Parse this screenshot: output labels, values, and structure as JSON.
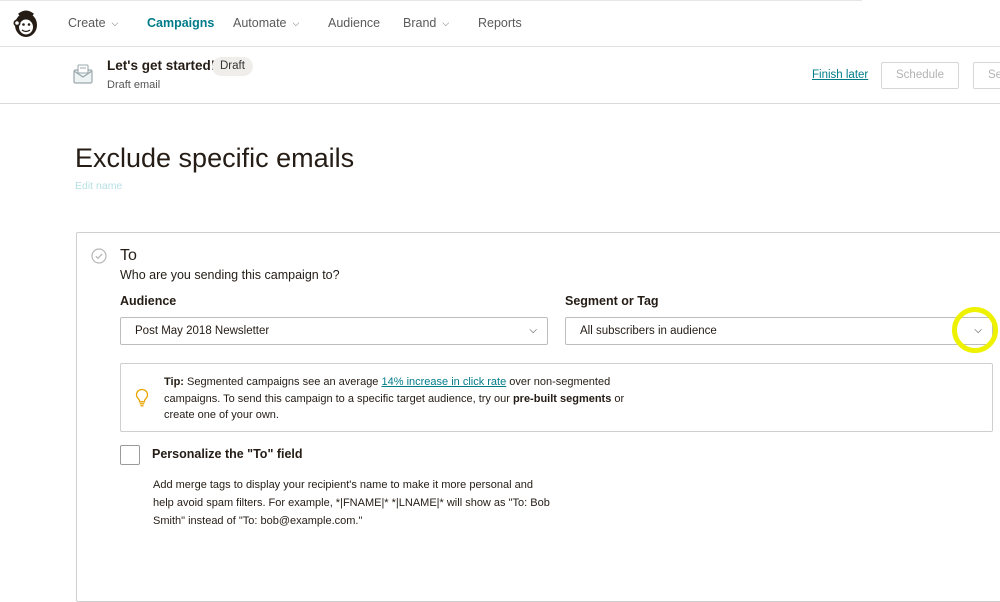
{
  "nav": {
    "items": [
      {
        "label": "Create",
        "has_menu": true
      },
      {
        "label": "Campaigns",
        "has_menu": false,
        "active": true
      },
      {
        "label": "Automate",
        "has_menu": true
      },
      {
        "label": "Audience",
        "has_menu": false
      },
      {
        "label": "Brand",
        "has_menu": true
      },
      {
        "label": "Reports",
        "has_menu": false
      }
    ]
  },
  "campaign": {
    "title": "Let's get started!",
    "status_badge": "Draft",
    "type": "Draft email",
    "finish_later": "Finish later",
    "schedule": "Schedule",
    "send": "Se"
  },
  "page": {
    "title": "Exclude specific emails",
    "edit_name": "Edit name"
  },
  "to_section": {
    "title": "To",
    "subtitle": "Who are you sending this campaign to?",
    "audience_label": "Audience",
    "audience_value": "Post May 2018 Newsletter",
    "segment_label": "Segment or Tag",
    "segment_value": "All subscribers in audience",
    "tip": {
      "prefix": "Tip:",
      "text_1": " Segmented campaigns see an average ",
      "link": "14% increase in click rate",
      "text_2": " over non-segmented campaigns. To send this campaign to a specific target audience, try our ",
      "bold": "pre-built segments",
      "text_3": " or create one of your own."
    },
    "personalize": {
      "label": "Personalize the \"To\" field",
      "checked": false,
      "description": "Add merge tags to display your recipient's name to make it more personal and help avoid spam filters. For example, *|FNAME|* *|LNAME|* will show as \"To: Bob Smith\" instead of \"To: bob@example.com.\""
    }
  },
  "colors": {
    "brand_teal": "#007c89",
    "highlight": "#eef200",
    "text": "#241c15"
  },
  "icons": [
    "mailchimp-logo-icon",
    "chevron-down-icon",
    "envelope-icon",
    "check-circle-icon",
    "lightbulb-icon"
  ]
}
